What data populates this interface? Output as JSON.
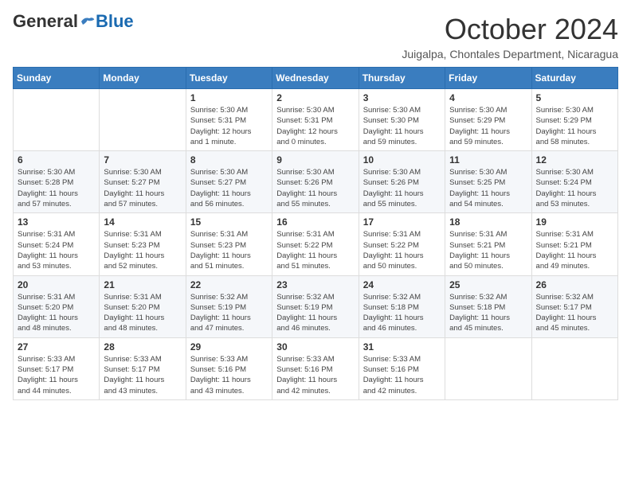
{
  "logo": {
    "general": "General",
    "blue": "Blue"
  },
  "header": {
    "month": "October 2024",
    "location": "Juigalpa, Chontales Department, Nicaragua"
  },
  "weekdays": [
    "Sunday",
    "Monday",
    "Tuesday",
    "Wednesday",
    "Thursday",
    "Friday",
    "Saturday"
  ],
  "weeks": [
    [
      {
        "day": "",
        "info": ""
      },
      {
        "day": "",
        "info": ""
      },
      {
        "day": "1",
        "info": "Sunrise: 5:30 AM\nSunset: 5:31 PM\nDaylight: 12 hours\nand 1 minute."
      },
      {
        "day": "2",
        "info": "Sunrise: 5:30 AM\nSunset: 5:31 PM\nDaylight: 12 hours\nand 0 minutes."
      },
      {
        "day": "3",
        "info": "Sunrise: 5:30 AM\nSunset: 5:30 PM\nDaylight: 11 hours\nand 59 minutes."
      },
      {
        "day": "4",
        "info": "Sunrise: 5:30 AM\nSunset: 5:29 PM\nDaylight: 11 hours\nand 59 minutes."
      },
      {
        "day": "5",
        "info": "Sunrise: 5:30 AM\nSunset: 5:29 PM\nDaylight: 11 hours\nand 58 minutes."
      }
    ],
    [
      {
        "day": "6",
        "info": "Sunrise: 5:30 AM\nSunset: 5:28 PM\nDaylight: 11 hours\nand 57 minutes."
      },
      {
        "day": "7",
        "info": "Sunrise: 5:30 AM\nSunset: 5:27 PM\nDaylight: 11 hours\nand 57 minutes."
      },
      {
        "day": "8",
        "info": "Sunrise: 5:30 AM\nSunset: 5:27 PM\nDaylight: 11 hours\nand 56 minutes."
      },
      {
        "day": "9",
        "info": "Sunrise: 5:30 AM\nSunset: 5:26 PM\nDaylight: 11 hours\nand 55 minutes."
      },
      {
        "day": "10",
        "info": "Sunrise: 5:30 AM\nSunset: 5:26 PM\nDaylight: 11 hours\nand 55 minutes."
      },
      {
        "day": "11",
        "info": "Sunrise: 5:30 AM\nSunset: 5:25 PM\nDaylight: 11 hours\nand 54 minutes."
      },
      {
        "day": "12",
        "info": "Sunrise: 5:30 AM\nSunset: 5:24 PM\nDaylight: 11 hours\nand 53 minutes."
      }
    ],
    [
      {
        "day": "13",
        "info": "Sunrise: 5:31 AM\nSunset: 5:24 PM\nDaylight: 11 hours\nand 53 minutes."
      },
      {
        "day": "14",
        "info": "Sunrise: 5:31 AM\nSunset: 5:23 PM\nDaylight: 11 hours\nand 52 minutes."
      },
      {
        "day": "15",
        "info": "Sunrise: 5:31 AM\nSunset: 5:23 PM\nDaylight: 11 hours\nand 51 minutes."
      },
      {
        "day": "16",
        "info": "Sunrise: 5:31 AM\nSunset: 5:22 PM\nDaylight: 11 hours\nand 51 minutes."
      },
      {
        "day": "17",
        "info": "Sunrise: 5:31 AM\nSunset: 5:22 PM\nDaylight: 11 hours\nand 50 minutes."
      },
      {
        "day": "18",
        "info": "Sunrise: 5:31 AM\nSunset: 5:21 PM\nDaylight: 11 hours\nand 50 minutes."
      },
      {
        "day": "19",
        "info": "Sunrise: 5:31 AM\nSunset: 5:21 PM\nDaylight: 11 hours\nand 49 minutes."
      }
    ],
    [
      {
        "day": "20",
        "info": "Sunrise: 5:31 AM\nSunset: 5:20 PM\nDaylight: 11 hours\nand 48 minutes."
      },
      {
        "day": "21",
        "info": "Sunrise: 5:31 AM\nSunset: 5:20 PM\nDaylight: 11 hours\nand 48 minutes."
      },
      {
        "day": "22",
        "info": "Sunrise: 5:32 AM\nSunset: 5:19 PM\nDaylight: 11 hours\nand 47 minutes."
      },
      {
        "day": "23",
        "info": "Sunrise: 5:32 AM\nSunset: 5:19 PM\nDaylight: 11 hours\nand 46 minutes."
      },
      {
        "day": "24",
        "info": "Sunrise: 5:32 AM\nSunset: 5:18 PM\nDaylight: 11 hours\nand 46 minutes."
      },
      {
        "day": "25",
        "info": "Sunrise: 5:32 AM\nSunset: 5:18 PM\nDaylight: 11 hours\nand 45 minutes."
      },
      {
        "day": "26",
        "info": "Sunrise: 5:32 AM\nSunset: 5:17 PM\nDaylight: 11 hours\nand 45 minutes."
      }
    ],
    [
      {
        "day": "27",
        "info": "Sunrise: 5:33 AM\nSunset: 5:17 PM\nDaylight: 11 hours\nand 44 minutes."
      },
      {
        "day": "28",
        "info": "Sunrise: 5:33 AM\nSunset: 5:17 PM\nDaylight: 11 hours\nand 43 minutes."
      },
      {
        "day": "29",
        "info": "Sunrise: 5:33 AM\nSunset: 5:16 PM\nDaylight: 11 hours\nand 43 minutes."
      },
      {
        "day": "30",
        "info": "Sunrise: 5:33 AM\nSunset: 5:16 PM\nDaylight: 11 hours\nand 42 minutes."
      },
      {
        "day": "31",
        "info": "Sunrise: 5:33 AM\nSunset: 5:16 PM\nDaylight: 11 hours\nand 42 minutes."
      },
      {
        "day": "",
        "info": ""
      },
      {
        "day": "",
        "info": ""
      }
    ]
  ]
}
